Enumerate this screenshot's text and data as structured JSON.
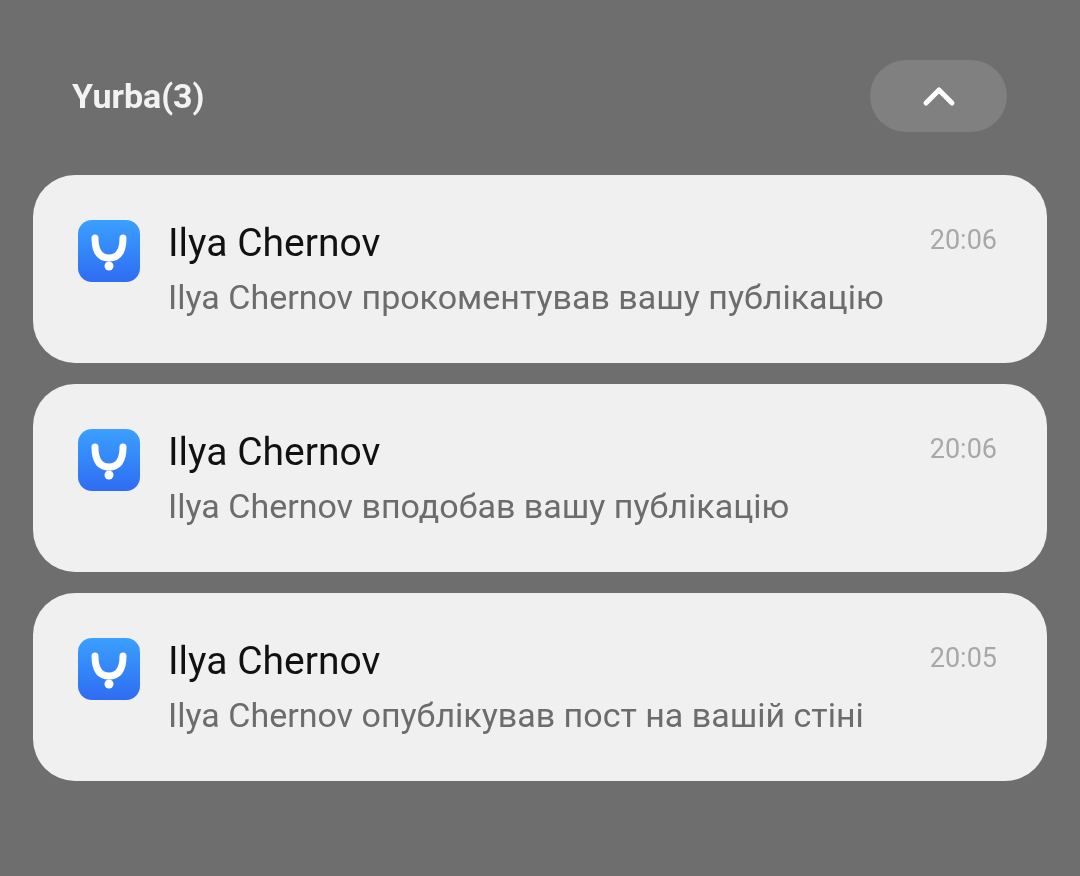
{
  "group": {
    "title": "Yurba(3)",
    "expanded": true
  },
  "notifications": [
    {
      "title": "Ilya Chernov",
      "time": "20:06",
      "text": "Ilya Chernov прокоментував вашу публікацію"
    },
    {
      "title": "Ilya Chernov",
      "time": "20:06",
      "text": "Ilya Chernov вподобав вашу публікацію"
    },
    {
      "title": "Ilya Chernov",
      "time": "20:05",
      "text": "Ilya Chernov опублікував пост на вашій стіні"
    }
  ]
}
